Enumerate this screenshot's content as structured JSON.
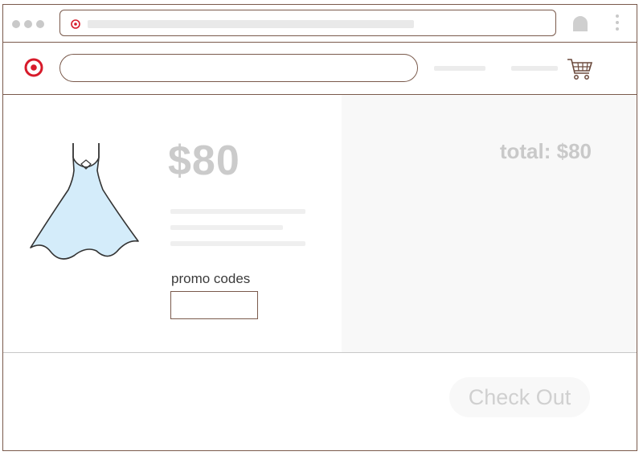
{
  "product": {
    "price": "$80"
  },
  "promo": {
    "label": "promo codes",
    "value": ""
  },
  "summary": {
    "total": "total: $80"
  },
  "actions": {
    "checkout_label": "Check Out"
  },
  "colors": {
    "brand": "#d71a2a",
    "border": "#7a5a4c",
    "dress_fill": "#d4ecfa",
    "muted_text": "#c9c9c9"
  },
  "icons": {
    "browser_dots": "window-controls-icon",
    "favicon": "target-logo-icon",
    "profile": "profile-icon",
    "menu": "kebab-menu-icon",
    "logo": "target-logo-icon",
    "cart": "shopping-cart-icon",
    "product": "dress-icon"
  }
}
